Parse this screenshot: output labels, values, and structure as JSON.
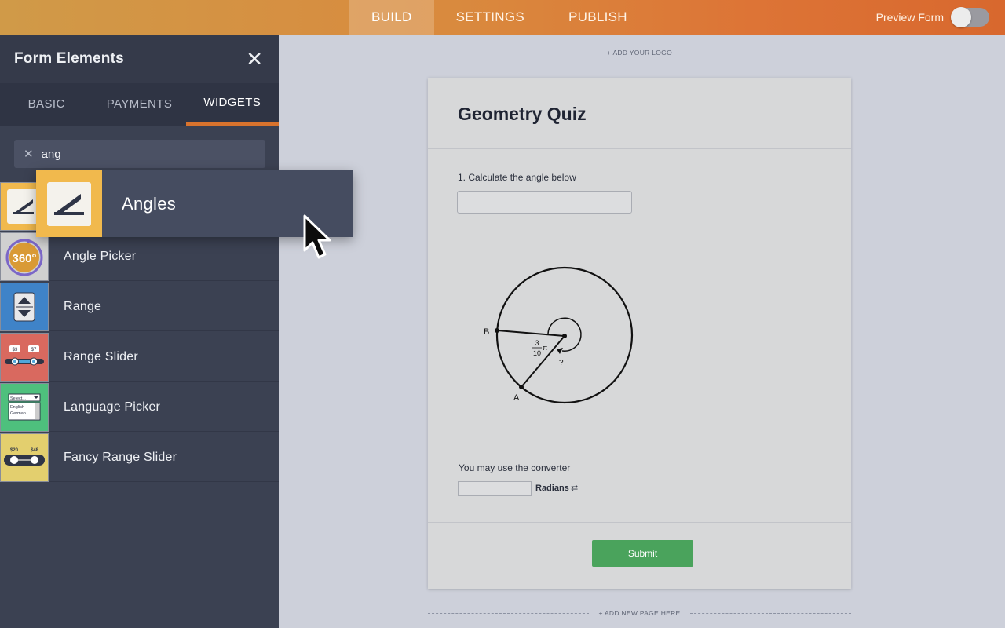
{
  "topbar": {
    "tabs": [
      {
        "label": "BUILD",
        "active": true
      },
      {
        "label": "SETTINGS",
        "active": false
      },
      {
        "label": "PUBLISH",
        "active": false
      }
    ],
    "preview_label": "Preview Form",
    "preview_on": false
  },
  "sidebar": {
    "title": "Form Elements",
    "tabs": [
      {
        "label": "BASIC",
        "active": false
      },
      {
        "label": "PAYMENTS",
        "active": false
      },
      {
        "label": "WIDGETS",
        "active": true
      }
    ],
    "search_value": "ang",
    "items": [
      {
        "label": "Angles",
        "icon": "angle-icon",
        "color": "#f1b94d"
      },
      {
        "label": "Angle Picker",
        "icon": "360-icon",
        "color": "#d0d0d0"
      },
      {
        "label": "Range",
        "icon": "up-down-arrows-icon",
        "color": "#3f83c8"
      },
      {
        "label": "Range Slider",
        "icon": "range-slider-icon",
        "color": "#d9695f"
      },
      {
        "label": "Language Picker",
        "icon": "select-list-icon",
        "color": "#4ec07d"
      },
      {
        "label": "Fancy Range Slider",
        "icon": "fancy-slider-icon",
        "color": "#e3cf6e"
      }
    ],
    "thumb_texts": {
      "angle_picker": "360°",
      "range_slider_low": "$3",
      "range_slider_high": "$7",
      "lang_select": "Select...",
      "lang_option_1": "English",
      "lang_option_2": "German",
      "fancy_low": "$20",
      "fancy_high": "$48"
    }
  },
  "drag_ghost": {
    "label": "Angles",
    "icon": "angle-icon"
  },
  "canvas": {
    "add_logo": "+ ADD YOUR LOGO",
    "add_page": "+ ADD NEW PAGE HERE"
  },
  "form": {
    "title": "Geometry Quiz",
    "question_label": "1. Calculate the angle below",
    "answer_value": "",
    "diagram": {
      "point_b": "B",
      "point_a": "A",
      "angle_numerator": "3",
      "angle_denominator": "10",
      "angle_pi": "π",
      "unknown": "?"
    },
    "converter_label": "You may use the converter",
    "converter_value": "",
    "converter_unit": "Radians",
    "submit_label": "Submit"
  },
  "colors": {
    "accent": "#d9732d",
    "sidebar_bg": "#3b4152",
    "submit": "#4aa35c"
  }
}
